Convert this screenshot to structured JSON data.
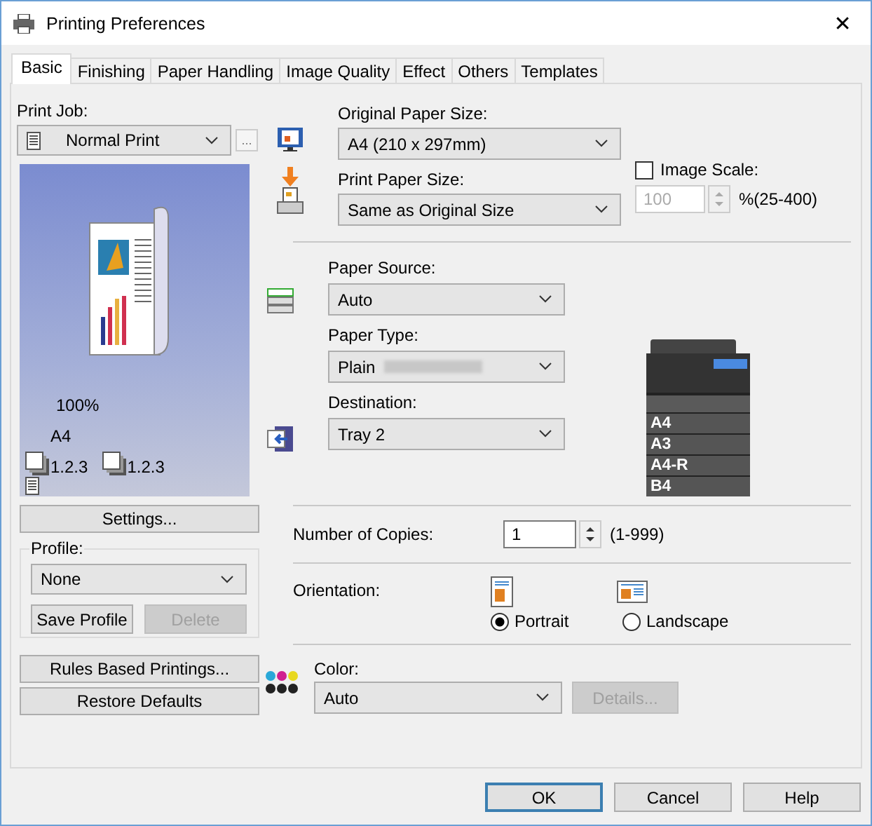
{
  "window": {
    "title": "Printing Preferences",
    "close": "✕"
  },
  "tabs": [
    {
      "label": "Basic",
      "selected": true
    },
    {
      "label": "Finishing",
      "selected": false
    },
    {
      "label": "Paper Handling",
      "selected": false
    },
    {
      "label": "Image Quality",
      "selected": false
    },
    {
      "label": "Effect",
      "selected": false
    },
    {
      "label": "Others",
      "selected": false
    },
    {
      "label": "Templates",
      "selected": false
    }
  ],
  "print_job": {
    "label": "Print Job:",
    "value": "Normal Print",
    "more_button": "..."
  },
  "preview": {
    "zoom": "100%",
    "paper": "A4",
    "collate": [
      "1.2.3",
      "1.2.3"
    ]
  },
  "settings_button": "Settings...",
  "profile": {
    "label": "Profile:",
    "value": "None",
    "buttons": [
      {
        "label": "Save Profile",
        "disabled": false
      },
      {
        "label": "Delete",
        "disabled": true
      }
    ]
  },
  "side_buttons": [
    "Rules Based Printings...",
    "Restore Defaults"
  ],
  "original_paper_size": {
    "label": "Original Paper Size:",
    "value": "A4 (210 x 297mm)"
  },
  "print_paper_size": {
    "label": "Print Paper Size:",
    "value": "Same as Original Size"
  },
  "image_scale": {
    "label": "Image Scale:",
    "checked": false,
    "value": "100",
    "range": "%(25-400)"
  },
  "paper_source": {
    "label": "Paper Source:",
    "value": "Auto"
  },
  "paper_type": {
    "label": "Paper Type:",
    "value": "Plain",
    "redacted": true
  },
  "destination": {
    "label": "Destination:",
    "value": "Tray 2"
  },
  "printer_trays": [
    "A4",
    "A3",
    "A4-R",
    "B4"
  ],
  "copies": {
    "label": "Number of Copies:",
    "value": "1",
    "range": "(1-999)"
  },
  "orientation": {
    "label": "Orientation:",
    "options": [
      {
        "kind": "portrait",
        "label": "Portrait",
        "selected": true
      },
      {
        "kind": "landscape",
        "label": "Landscape",
        "selected": false
      }
    ]
  },
  "color": {
    "label": "Color:",
    "value": "Auto",
    "details_button": {
      "label": "Details...",
      "disabled": true
    }
  },
  "buttons": [
    {
      "label": "OK",
      "focused": true
    },
    {
      "label": "Cancel",
      "focused": false
    },
    {
      "label": "Help",
      "focused": false
    }
  ]
}
